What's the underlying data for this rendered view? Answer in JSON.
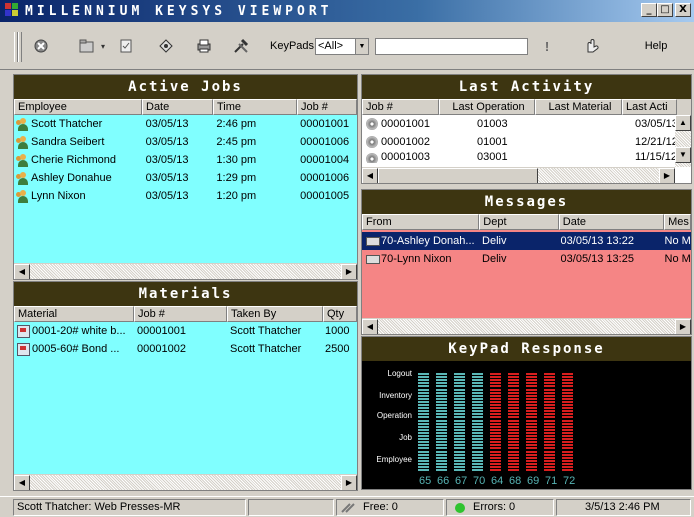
{
  "window": {
    "title": "MILLENNIUM KEYSYS VIEWPORT",
    "minimize": "_",
    "maximize": "□",
    "close": "X"
  },
  "toolbar": {
    "keypads_label": "KeyPads:",
    "keypads_value": "<All>",
    "keypads_input": "",
    "help_label": "Help"
  },
  "active_jobs": {
    "title": "Active Jobs",
    "columns": [
      "Employee",
      "Date",
      "Time",
      "Job #"
    ],
    "rows": [
      [
        "Scott Thatcher",
        "03/05/13",
        "2:46 pm",
        "00001001"
      ],
      [
        "Sandra Seibert",
        "03/05/13",
        "2:45 pm",
        "00001006"
      ],
      [
        "Cherie Richmond",
        "03/05/13",
        "1:30 pm",
        "00001004"
      ],
      [
        "Ashley Donahue",
        "03/05/13",
        "1:29 pm",
        "00001006"
      ],
      [
        "Lynn Nixon",
        "03/05/13",
        "1:20 pm",
        "00001005"
      ]
    ]
  },
  "materials": {
    "title": "Materials",
    "columns": [
      "Material",
      "Job #",
      "Taken By",
      "Qty"
    ],
    "rows": [
      [
        "0001-20# white b...",
        "00001001",
        "Scott Thatcher",
        "1000"
      ],
      [
        "0005-60# Bond ...",
        "00001002",
        "Scott Thatcher",
        "2500"
      ]
    ]
  },
  "last_activity": {
    "title": "Last Activity",
    "columns": [
      "Job #",
      "Last Operation",
      "Last Material",
      "Last Acti"
    ],
    "rows": [
      [
        "00001001",
        "01003",
        "",
        "03/05/13"
      ],
      [
        "00001002",
        "01001",
        "",
        "12/21/12"
      ],
      [
        "00001003",
        "03001",
        "",
        "11/15/12"
      ]
    ]
  },
  "messages": {
    "title": "Messages",
    "columns": [
      "From",
      "Dept",
      "Date",
      "Mes"
    ],
    "rows": [
      [
        "70-Ashley Donah...",
        "Deliv",
        "03/05/13 13:22",
        "No M"
      ],
      [
        "70-Lynn Nixon",
        "Deliv",
        "03/05/13 13:25",
        "No M"
      ]
    ]
  },
  "keypad_response": {
    "title": "KeyPad Response",
    "row_labels": [
      "Logout",
      "Inventory",
      "Operation",
      "Job",
      "Employee"
    ],
    "keypads": [
      "65",
      "66",
      "67",
      "70",
      "64",
      "68",
      "69",
      "71",
      "72"
    ],
    "colors": {
      "active": "#5ab7b7",
      "inactive": "#d81e1e",
      "dim": "#7a1414"
    },
    "states": [
      "active",
      "active",
      "active",
      "active",
      "inactive",
      "inactive",
      "inactive",
      "inactive",
      "inactive"
    ]
  },
  "statusbar": {
    "context": "Scott Thatcher: Web Presses-MR",
    "free": "Free: 0",
    "errors": "Errors: 0",
    "datetime": "3/5/13   2:46 PM"
  }
}
